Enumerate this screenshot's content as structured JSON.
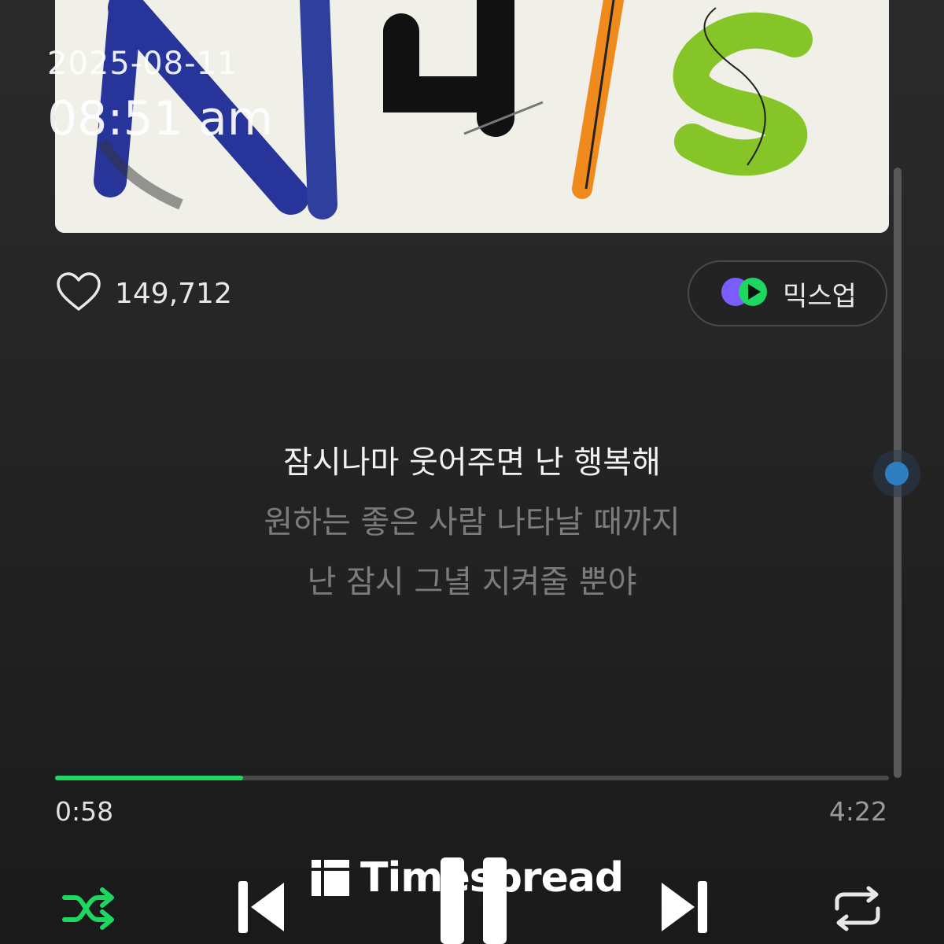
{
  "overlay": {
    "date": "2025-08-11",
    "time": "08:51 am"
  },
  "track": {
    "like_count": "149,712",
    "mixup_label": "믹스업"
  },
  "lyrics": [
    {
      "text": "잠시나마 웃어주면 난 행복해",
      "active": true
    },
    {
      "text": "원하는 좋은 사람 나타날 때까지",
      "active": false
    },
    {
      "text": "난 잠시 그녈 지켜줄 뿐야",
      "active": false
    }
  ],
  "player": {
    "elapsed": "0:58",
    "duration": "4:22",
    "progress_fraction": 0.225
  },
  "controls": [
    "shuffle-icon",
    "previous-icon",
    "pause-icon",
    "next-icon",
    "repeat-icon"
  ],
  "watermark": {
    "text": "Timespread"
  },
  "colors": {
    "accent_green": "#1ed760",
    "scroll_blue": "#2f7fc0"
  }
}
